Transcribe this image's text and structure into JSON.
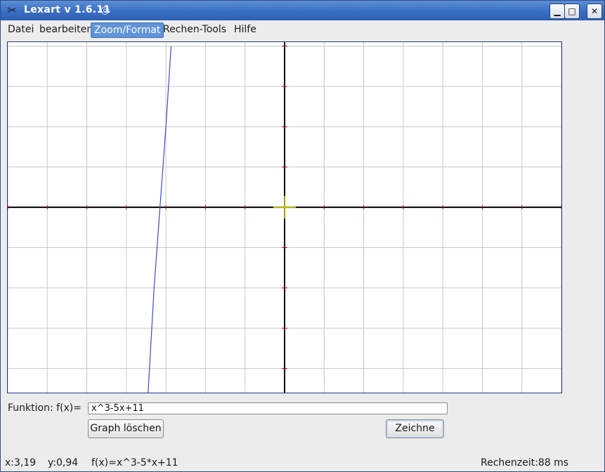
{
  "window": {
    "title": "Lexart v 1.6.11",
    "app_icon": "scissors-x-icon",
    "logo_icon": "swirl-logo-icon",
    "controls": [
      "minimize-icon",
      "maximize-icon",
      "close-icon"
    ]
  },
  "menu": [
    {
      "label": "Datei",
      "active": false
    },
    {
      "label": "bearbeiten",
      "active": false
    },
    {
      "label": "Zoom/Format",
      "active": true
    },
    {
      "label": "Rechen-Tools",
      "active": false
    },
    {
      "label": "Hilfe",
      "active": false
    }
  ],
  "colors": {
    "plot_border": "#25308f",
    "grid": "#c8c8c8",
    "axis": "#000000",
    "tick": "#cc0000",
    "curve": "#3b4bc7",
    "crosshair": "#d8d800",
    "menu_active": "#5f95d6"
  },
  "chart_data": {
    "type": "line",
    "function": "x^3-5x+11",
    "xlim": [
      -7,
      7
    ],
    "ylim": [
      -4.6,
      4.1
    ],
    "grid": true,
    "curve_points": [
      {
        "x": -2.87,
        "y": 4.0
      },
      {
        "x": -3.0,
        "y": 2.0
      },
      {
        "x": -3.15,
        "y": 0.0
      },
      {
        "x": -3.3,
        "y": -2.0
      },
      {
        "x": -3.45,
        "y": -4.6
      }
    ],
    "crosshair": {
      "x": 0,
      "y": 0
    }
  },
  "form": {
    "function_label": "Funktion: f(x)=",
    "function_value": "x^3-5x+11",
    "clear_label": "Graph löschen",
    "draw_label": "Zeichne"
  },
  "status": {
    "x": "x:3,19",
    "y": "y:0,94",
    "fx": "f(x)=x^3-5*x+11",
    "time": "Rechenzeit:88 ms"
  }
}
